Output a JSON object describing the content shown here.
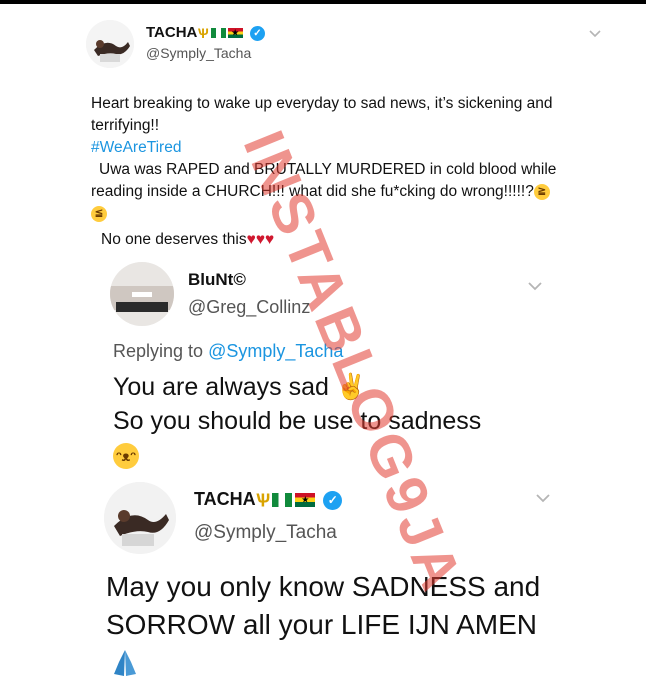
{
  "tweet1": {
    "name": "TACHA",
    "handle": "@Symply_Tacha",
    "line1": "Heart breaking to wake up everyday to sad news, it’s sickening and",
    "line2": "terrifying!!",
    "hashtag": "#WeAreTired",
    "line3": "Uwa was RAPED and BRUTALLY MURDERED in cold blood while",
    "line4": "reading inside a CHURCH!!! what did she fu*cking do wrong!!!!!?",
    "line5": "No one deserves this"
  },
  "tweet2": {
    "name": "BluNt©",
    "handle": "@Greg_Collinz",
    "replying_prefix": "Replying to",
    "replying_handle": "@Symply_Tacha",
    "line1": "You are always sad",
    "line2": "So you should be use to sadness"
  },
  "tweet3": {
    "name": "TACHA",
    "handle": "@Symply_Tacha",
    "line1": "May you only know SADNESS and",
    "line2": "SORROW all your LIFE IJN AMEN"
  },
  "icons": {
    "verified": "verified-check",
    "chevron": "chevron-down",
    "trident": "trident-emoji",
    "flag_nigeria": "nigeria-flag",
    "flag_ghana": "ghana-flag"
  },
  "watermark": "INSTABLOG9JA"
}
